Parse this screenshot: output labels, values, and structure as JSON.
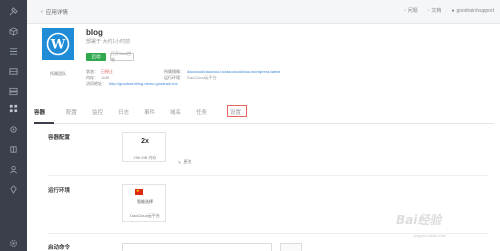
{
  "topbar": {
    "back_label": "应用详情",
    "right_items": [
      {
        "icon": "doc-icon",
        "label": "问题"
      },
      {
        "icon": "user-icon",
        "label": "文档"
      },
      {
        "icon": "avatar-icon",
        "label": "goodrain/support"
      }
    ]
  },
  "app": {
    "name": "blog",
    "status_text": "部署于 大约1小时前",
    "start_label": "启动",
    "manage_label": "打开Web控制",
    "info": {
      "owner_label": "所属团队",
      "owner_value": "",
      "status_label": "状态：",
      "status_value": "已停止",
      "memory_label": "内存：",
      "memory_value": "1MB",
      "access_label": "访问地址：",
      "access_value": "http://goodrain/blog.demo.goodrain.me",
      "image_label": "所属镜像：",
      "image_value": "daocloud/daocloud.io/daocloud/dao-wordpress:latest",
      "cluster_label": "运行环境：",
      "cluster_value": "DaoCloud云平台"
    }
  },
  "tabs": [
    {
      "label": "容器",
      "active": true
    },
    {
      "label": "配置",
      "active": false
    },
    {
      "label": "监控",
      "active": false
    },
    {
      "label": "日志",
      "active": false
    },
    {
      "label": "事件",
      "active": false
    },
    {
      "label": "域名",
      "active": false
    },
    {
      "label": "任务",
      "active": false
    },
    {
      "label": "设置",
      "active": false
    }
  ],
  "sections": {
    "container_config_title": "容器配置",
    "scale": "2x",
    "memory": "256 MB 内存",
    "edit_label": "更改",
    "runtime_title": "运行环境",
    "region": "智能选择",
    "provider": "DaoCloud云平台",
    "start_cmd_title": "启动命令"
  },
  "watermark": {
    "text": "Bai经验",
    "sub": "jingyan.baidu.com"
  },
  "colors": {
    "sidebar": "#3b3f4b",
    "accent_green": "#2fa84f",
    "logo_blue": "#1e8cd6",
    "highlight_red": "#e8655e"
  },
  "sidebar_icons": [
    "tools-icon",
    "cube-icon",
    "list-icon",
    "layers-icon",
    "server-icon",
    "grid-icon",
    "settings-icon",
    "puzzle-icon",
    "user-icon",
    "pin-icon",
    "gear-icon"
  ]
}
